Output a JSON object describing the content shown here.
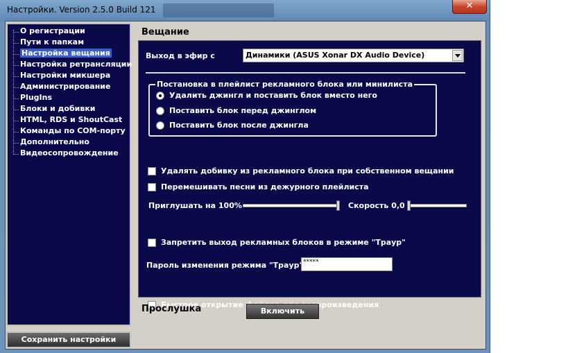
{
  "window": {
    "title": "Настройки. Version 2.5.0 Build 121",
    "close_glyph": "✕"
  },
  "sidebar": {
    "items": [
      {
        "label": "О регистрации",
        "selected": false
      },
      {
        "label": "Пути к папкам",
        "selected": false
      },
      {
        "label": "Настройка вещания",
        "selected": true
      },
      {
        "label": "Настройка ретрансляции",
        "selected": false
      },
      {
        "label": "Настройки микшера",
        "selected": false
      },
      {
        "label": "Администрирование",
        "selected": false
      },
      {
        "label": "PlugIns",
        "selected": false
      },
      {
        "label": "Блоки и добивки",
        "selected": false
      },
      {
        "label": "HTML, RDS и ShoutCast",
        "selected": false
      },
      {
        "label": "Команды по COM-порту",
        "selected": false
      },
      {
        "label": "Дополнительно",
        "selected": false
      },
      {
        "label": "Видеосопровождение",
        "selected": false
      }
    ],
    "save_label": "Сохранить настройки"
  },
  "broadcast": {
    "section_title": "Вещание",
    "output_label": "Выход в эфир с",
    "output_value": "Динамики (ASUS Xonar DX Audio Device)",
    "group_legend": "Постановка в плейлист рекламного блока или минилиста",
    "radios": [
      {
        "label": "Удалить джингл и поставить блок вместо него",
        "checked": true
      },
      {
        "label": "Поставить блок перед джинглом",
        "checked": false
      },
      {
        "label": "Поставить блок после джингла",
        "checked": false
      }
    ],
    "check_remove_filler": {
      "label": "Удалять добивку из рекламного блока при собственном вещании",
      "checked": false
    },
    "check_shuffle": {
      "label": "Перемешивать песни из дежурного плейлиста",
      "checked": false
    },
    "mute_label": "Приглушать на 100%",
    "mute_value_percent": 100,
    "speed_label": "Скорость 0,0",
    "speed_value": 0.0,
    "check_mourning": {
      "label": "Запретить выход рекламных блоков в режиме \"Траур\"",
      "checked": false
    },
    "password_label": "Пароль изменения режима \"Траур\"",
    "password_value": "*****",
    "check_fast_open": {
      "label": "Быстрое открытие файлов для воспроизведения",
      "checked": false
    }
  },
  "listen": {
    "label": "Прослушка",
    "button_label": "Включить"
  },
  "colors": {
    "panel_bg": "#0a0a4a",
    "selection": "#3a5fc8",
    "close_button": "#c9462c"
  }
}
